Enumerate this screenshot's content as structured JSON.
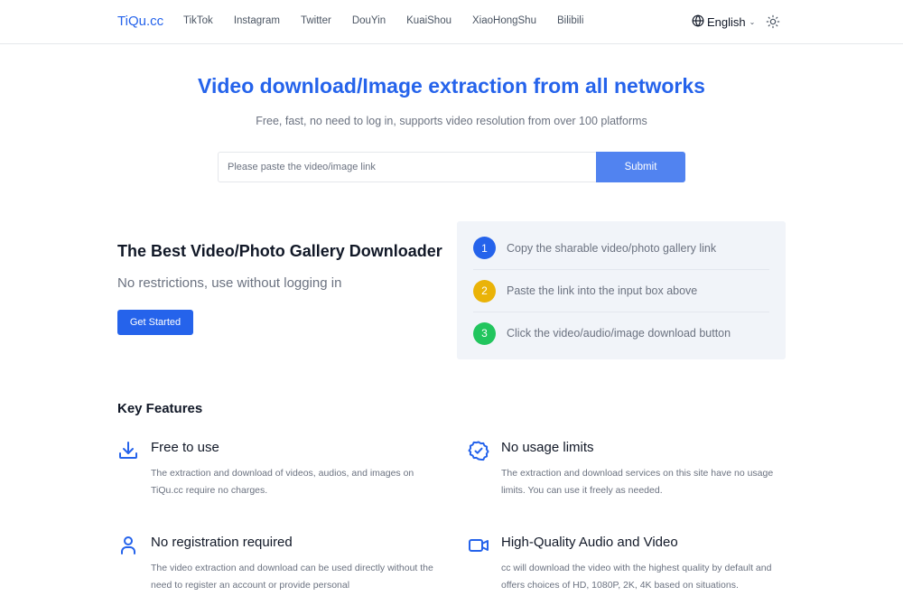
{
  "header": {
    "logo": "TiQu.cc",
    "nav": [
      "TikTok",
      "Instagram",
      "Twitter",
      "DouYin",
      "KuaiShou",
      "XiaoHongShu",
      "Bilibili"
    ],
    "language": "English",
    "icons": {
      "language": "globe-icon",
      "dropdown": "chevron-down-icon",
      "theme": "sun-icon"
    }
  },
  "hero": {
    "title": "Video download/Image extraction from all networks",
    "subtitle": "Free, fast, no need to log in, supports video resolution from over 100 platforms",
    "input_placeholder": "Please paste the video/image link",
    "input_value": "",
    "submit_label": "Submit"
  },
  "promo": {
    "title": "The Best Video/Photo Gallery Downloader",
    "subtitle": "No restrictions, use without logging in",
    "cta_label": "Get Started"
  },
  "steps": [
    {
      "number": "1",
      "text": "Copy the sharable video/photo gallery link",
      "color": "#2563eb"
    },
    {
      "number": "2",
      "text": "Paste the link into the input box above",
      "color": "#eab308"
    },
    {
      "number": "3",
      "text": "Click the video/audio/image download button",
      "color": "#22c55e"
    }
  ],
  "features": {
    "title": "Key Features",
    "items": [
      {
        "icon": "download-icon",
        "title": "Free to use",
        "description": "The extraction and download of videos, audios, and images on TiQu.cc require no charges."
      },
      {
        "icon": "badge-check-icon",
        "title": "No usage limits",
        "description": "The extraction and download services on this site have no usage limits. You can use it freely as needed."
      },
      {
        "icon": "user-icon",
        "title": "No registration required",
        "description": "The video extraction and download can be used directly without the need to register an account or provide personal"
      },
      {
        "icon": "video-camera-icon",
        "title": "High-Quality Audio and Video",
        "description": "cc will download the video with the highest quality by default and offers choices of HD, 1080P, 2K, 4K based on situations."
      }
    ]
  },
  "colors": {
    "accent": "#2563eb",
    "submit": "#5183f0",
    "steps_bg": "#f1f4f9",
    "muted_text": "#6b7280"
  }
}
